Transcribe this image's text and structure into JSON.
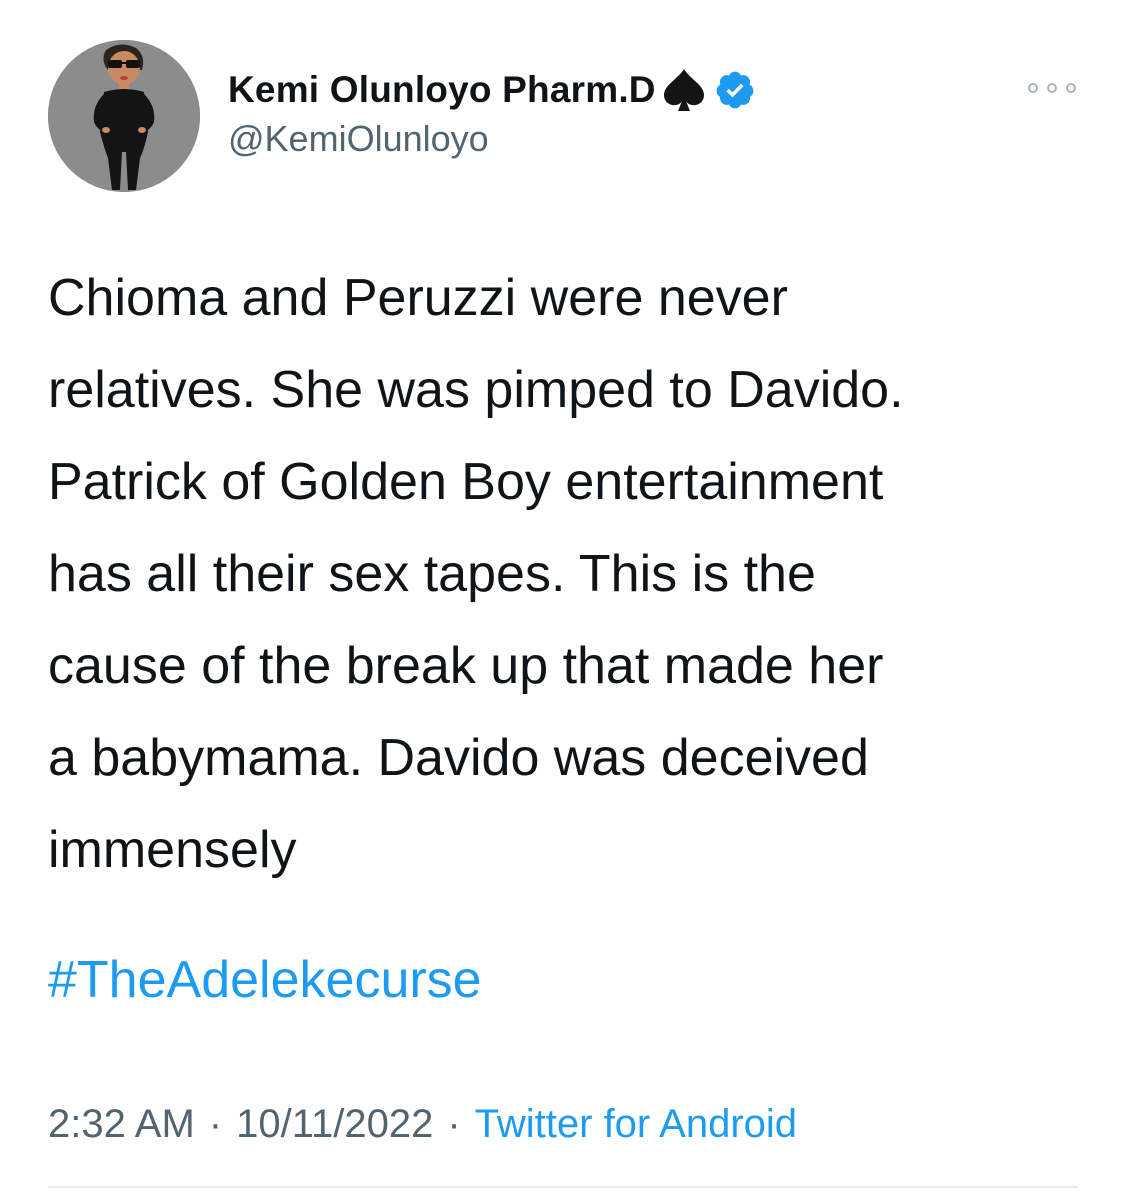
{
  "tweet": {
    "author": {
      "display_name": "Kemi Olunloyo Pharm.D",
      "badge_icon": "spade-icon",
      "verified_icon": "verified-badge-icon",
      "handle": "@KemiOlunloyo"
    },
    "text_lines": [
      "Chioma and Peruzzi were never",
      "relatives. She was pimped to Davido.",
      "Patrick of Golden Boy entertainment",
      "has all their sex tapes. This is the",
      "cause of the break up that made her",
      "a babymama. Davido was deceived",
      "immensely"
    ],
    "hashtag": "#TheAdelekecurse",
    "time": "2:32 AM",
    "date": "10/11/2022",
    "source": "Twitter for Android",
    "separator": "·"
  },
  "colors": {
    "text": "#0f1419",
    "secondary": "#536471",
    "link": "#1d9bf0",
    "divider": "#e6ecf0"
  }
}
